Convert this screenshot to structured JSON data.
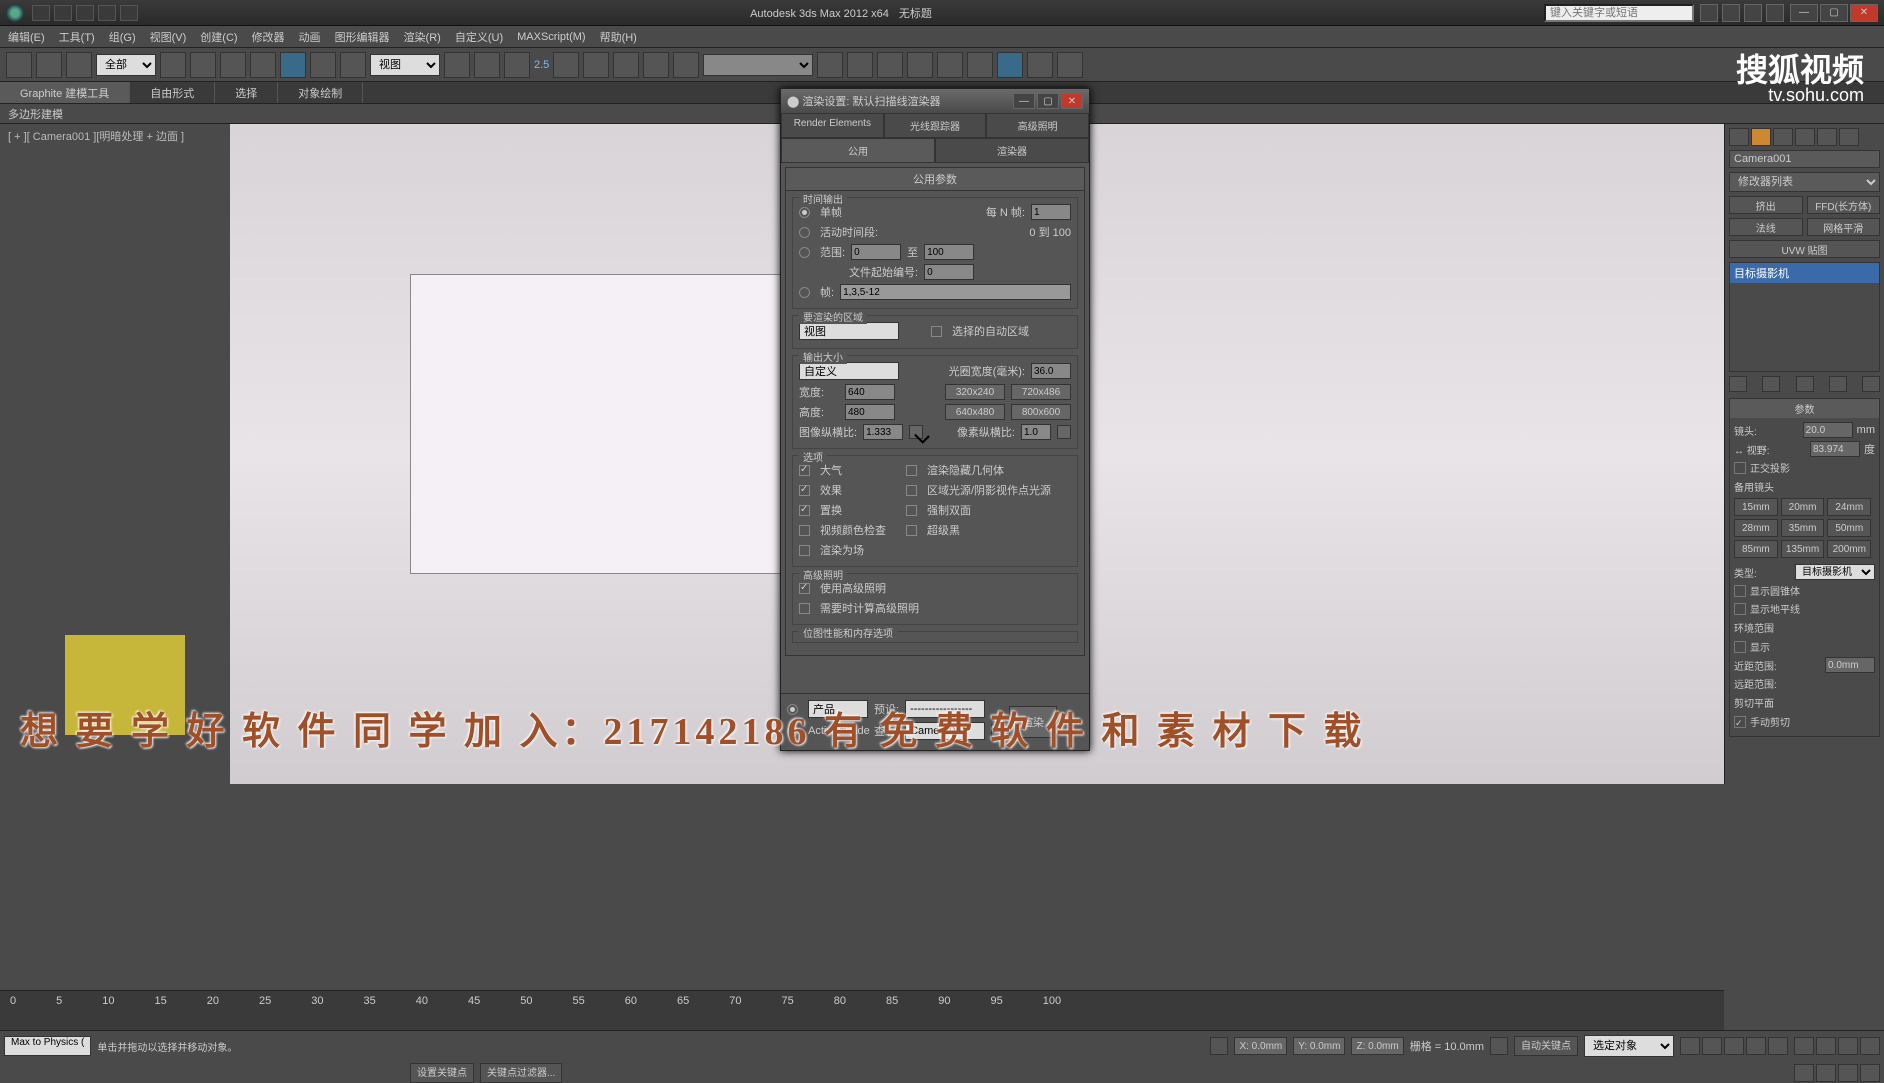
{
  "title": "Autodesk 3ds Max  2012 x64",
  "title_suffix": "无标题",
  "search_placeholder": "键入关键字或短语",
  "menu": [
    "编辑(E)",
    "工具(T)",
    "组(G)",
    "视图(V)",
    "创建(C)",
    "修改器",
    "动画",
    "图形编辑器",
    "渲染(R)",
    "自定义(U)",
    "MAXScript(M)",
    "帮助(H)"
  ],
  "toolbar": {
    "all": "全部",
    "view": "视图",
    "snap": "2.5"
  },
  "ribbon": {
    "tabs": [
      "Graphite 建模工具",
      "自由形式",
      "选择",
      "对象绘制"
    ],
    "sub": "多边形建模"
  },
  "viewport_label": "[ + ][ Camera001 ][明暗处理 + 边面 ]",
  "dialog": {
    "title": "渲染设置: 默认扫描线渲染器",
    "tabs_top": [
      "Render Elements",
      "光线跟踪器",
      "高级照明"
    ],
    "tabs_bot": [
      "公用",
      "渲染器"
    ],
    "rollout_common": "公用参数",
    "time_output": "时间输出",
    "single": "单帧",
    "every_n": "每 N 帧:",
    "every_n_val": "1",
    "active_seg": "活动时间段:",
    "seg_range": "0 到 100",
    "range": "范围:",
    "range_from": "0",
    "range_to_label": "至",
    "range_to": "100",
    "file_start": "文件起始编号:",
    "file_start_val": "0",
    "frames": "帧:",
    "frames_val": "1,3,5-12",
    "area_title": "要渲染的区域",
    "area_drop": "视图",
    "auto_region": "选择的自动区域",
    "output_size": "输出大小",
    "custom": "自定义",
    "aperture": "光圈宽度(毫米):",
    "aperture_val": "36.0",
    "width": "宽度:",
    "width_val": "640",
    "height": "高度:",
    "height_val": "480",
    "presets": [
      "320x240",
      "720x486",
      "640x480",
      "800x600"
    ],
    "img_aspect": "图像纵横比:",
    "img_aspect_val": "1.333",
    "pix_aspect": "像素纵横比:",
    "pix_aspect_val": "1.0",
    "options": "选项",
    "atmos": "大气",
    "hidden": "渲染隐藏几何体",
    "effects": "效果",
    "area_lights": "区域光源/阴影视作点光源",
    "displace": "置换",
    "force2": "强制双面",
    "vid_check": "视频颜色检查",
    "super_black": "超级黑",
    "render_fields": "渲染为场",
    "adv_light": "高级照明",
    "use_adv": "使用高级照明",
    "need_adv": "需要时计算高级照明",
    "bitmap": "位图性能和内存选项",
    "footer_prod": "产品",
    "footer_preset": "预设:",
    "footer_preset_val": "-----------------",
    "footer_active": "ActiveShade",
    "footer_view": "查看:",
    "footer_view_val": "Camera001",
    "render_btn": "渲染"
  },
  "right_panel": {
    "name": "Camera001",
    "modifier": "修改器列表",
    "btns": [
      "挤出",
      "FFD(长方体)",
      "法线",
      "网格平滑",
      "UVW 贴图"
    ],
    "list_item": "目标摄影机",
    "params": "参数",
    "lens": "镜头:",
    "lens_val": "20.0",
    "lens_unit": "mm",
    "fov": "↔ 视野:",
    "fov_val": "83.974",
    "fov_unit": "度",
    "ortho": "正交投影",
    "stock": "备用镜头",
    "lenses": [
      "15mm",
      "20mm",
      "24mm",
      "28mm",
      "35mm",
      "50mm",
      "85mm",
      "135mm",
      "200mm"
    ],
    "type": "类型:",
    "type_val": "目标摄影机",
    "show_cone": "显示圆锥体",
    "show_horizon": "显示地平线",
    "env_range": "环境范围",
    "show": "显示",
    "near_range": "近距范围:",
    "near_val": "0.0mm",
    "far_range": "远距范围:",
    "clip": "剪切平面",
    "manual": "手动剪切"
  },
  "timeline_marks": [
    0,
    5,
    10,
    15,
    20,
    25,
    30,
    35,
    40,
    45,
    50,
    55,
    60,
    65,
    70,
    75,
    80,
    85,
    90,
    95,
    100
  ],
  "status": {
    "script": "Max to Physics (",
    "prompt": "单击并拖动以选择并移动对象。",
    "x": "X: 0.0mm",
    "y": "Y: 0.0mm",
    "z": "Z: 0.0mm",
    "grid": "栅格 = 10.0mm",
    "auto_key": "自动关键点",
    "sel": "选定对象",
    "set_key": "设置关键点",
    "key_filter": "关键点过滤器..."
  },
  "overlay": "想 要 学 好 软 件 同 学 加 入：217142186 有 免 费 软 件 和 素 材 下 载",
  "wm1": "搜狐视频",
  "wm2": "tv.sohu.com"
}
